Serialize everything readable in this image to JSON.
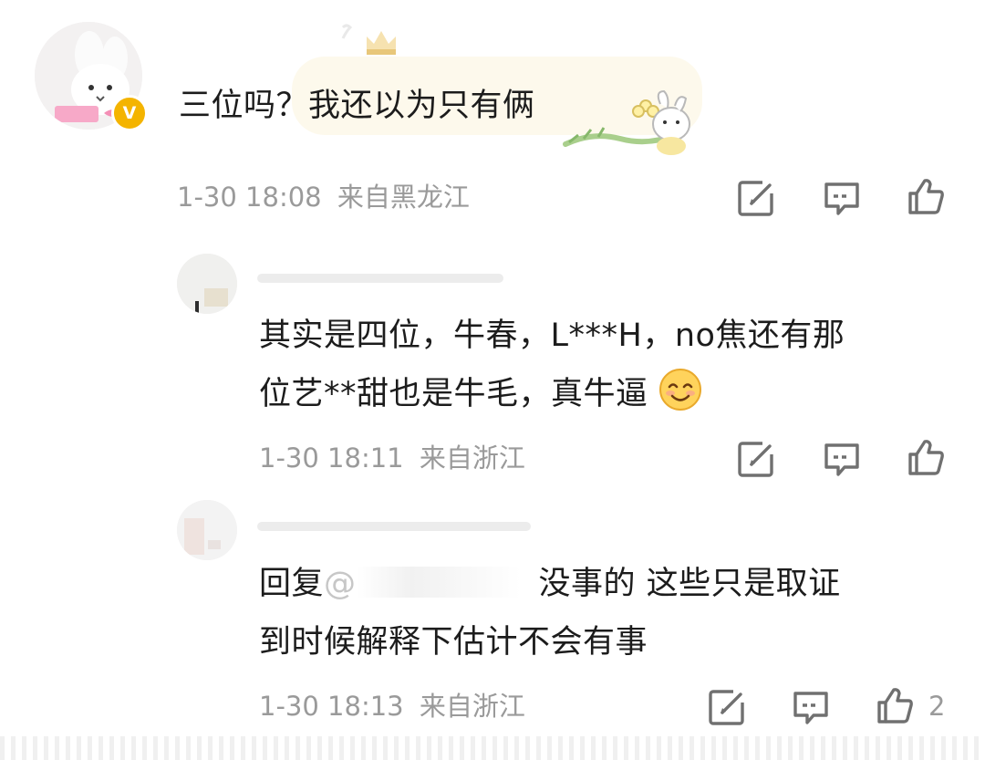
{
  "comments": [
    {
      "text_lines": [
        "三位吗？我还以为只有俩"
      ],
      "date": "1-30",
      "time": "18:08",
      "location": "来自黑龙江",
      "verified_badge": "V",
      "actions": [
        "edit-icon",
        "comment-icon",
        "like-icon"
      ]
    },
    {
      "text_lines": [
        "其实是四位，牛春，L***H，no焦还有那",
        "位艺**甜也是牛毛，真牛逼"
      ],
      "emoji": "smile-emoji",
      "date": "1-30",
      "time": "18:11",
      "location": "来自浙江",
      "actions": [
        "edit-icon",
        "comment-icon",
        "like-icon"
      ]
    },
    {
      "reply_prefix": "回复",
      "mention_at": "@",
      "text_after_mention": "没事的 这些只是取证",
      "text_line2": "到时候解释下估计不会有事",
      "date": "1-30",
      "time": "18:13",
      "location": "来自浙江",
      "like_count": "2",
      "actions": [
        "edit-icon",
        "comment-icon",
        "like-icon"
      ]
    }
  ],
  "colors": {
    "text": "#1c1c1c",
    "meta": "#9a9a9a",
    "icon": "#707070",
    "verified_badge": "#f4b400",
    "bubble": "#fdf9ec"
  }
}
